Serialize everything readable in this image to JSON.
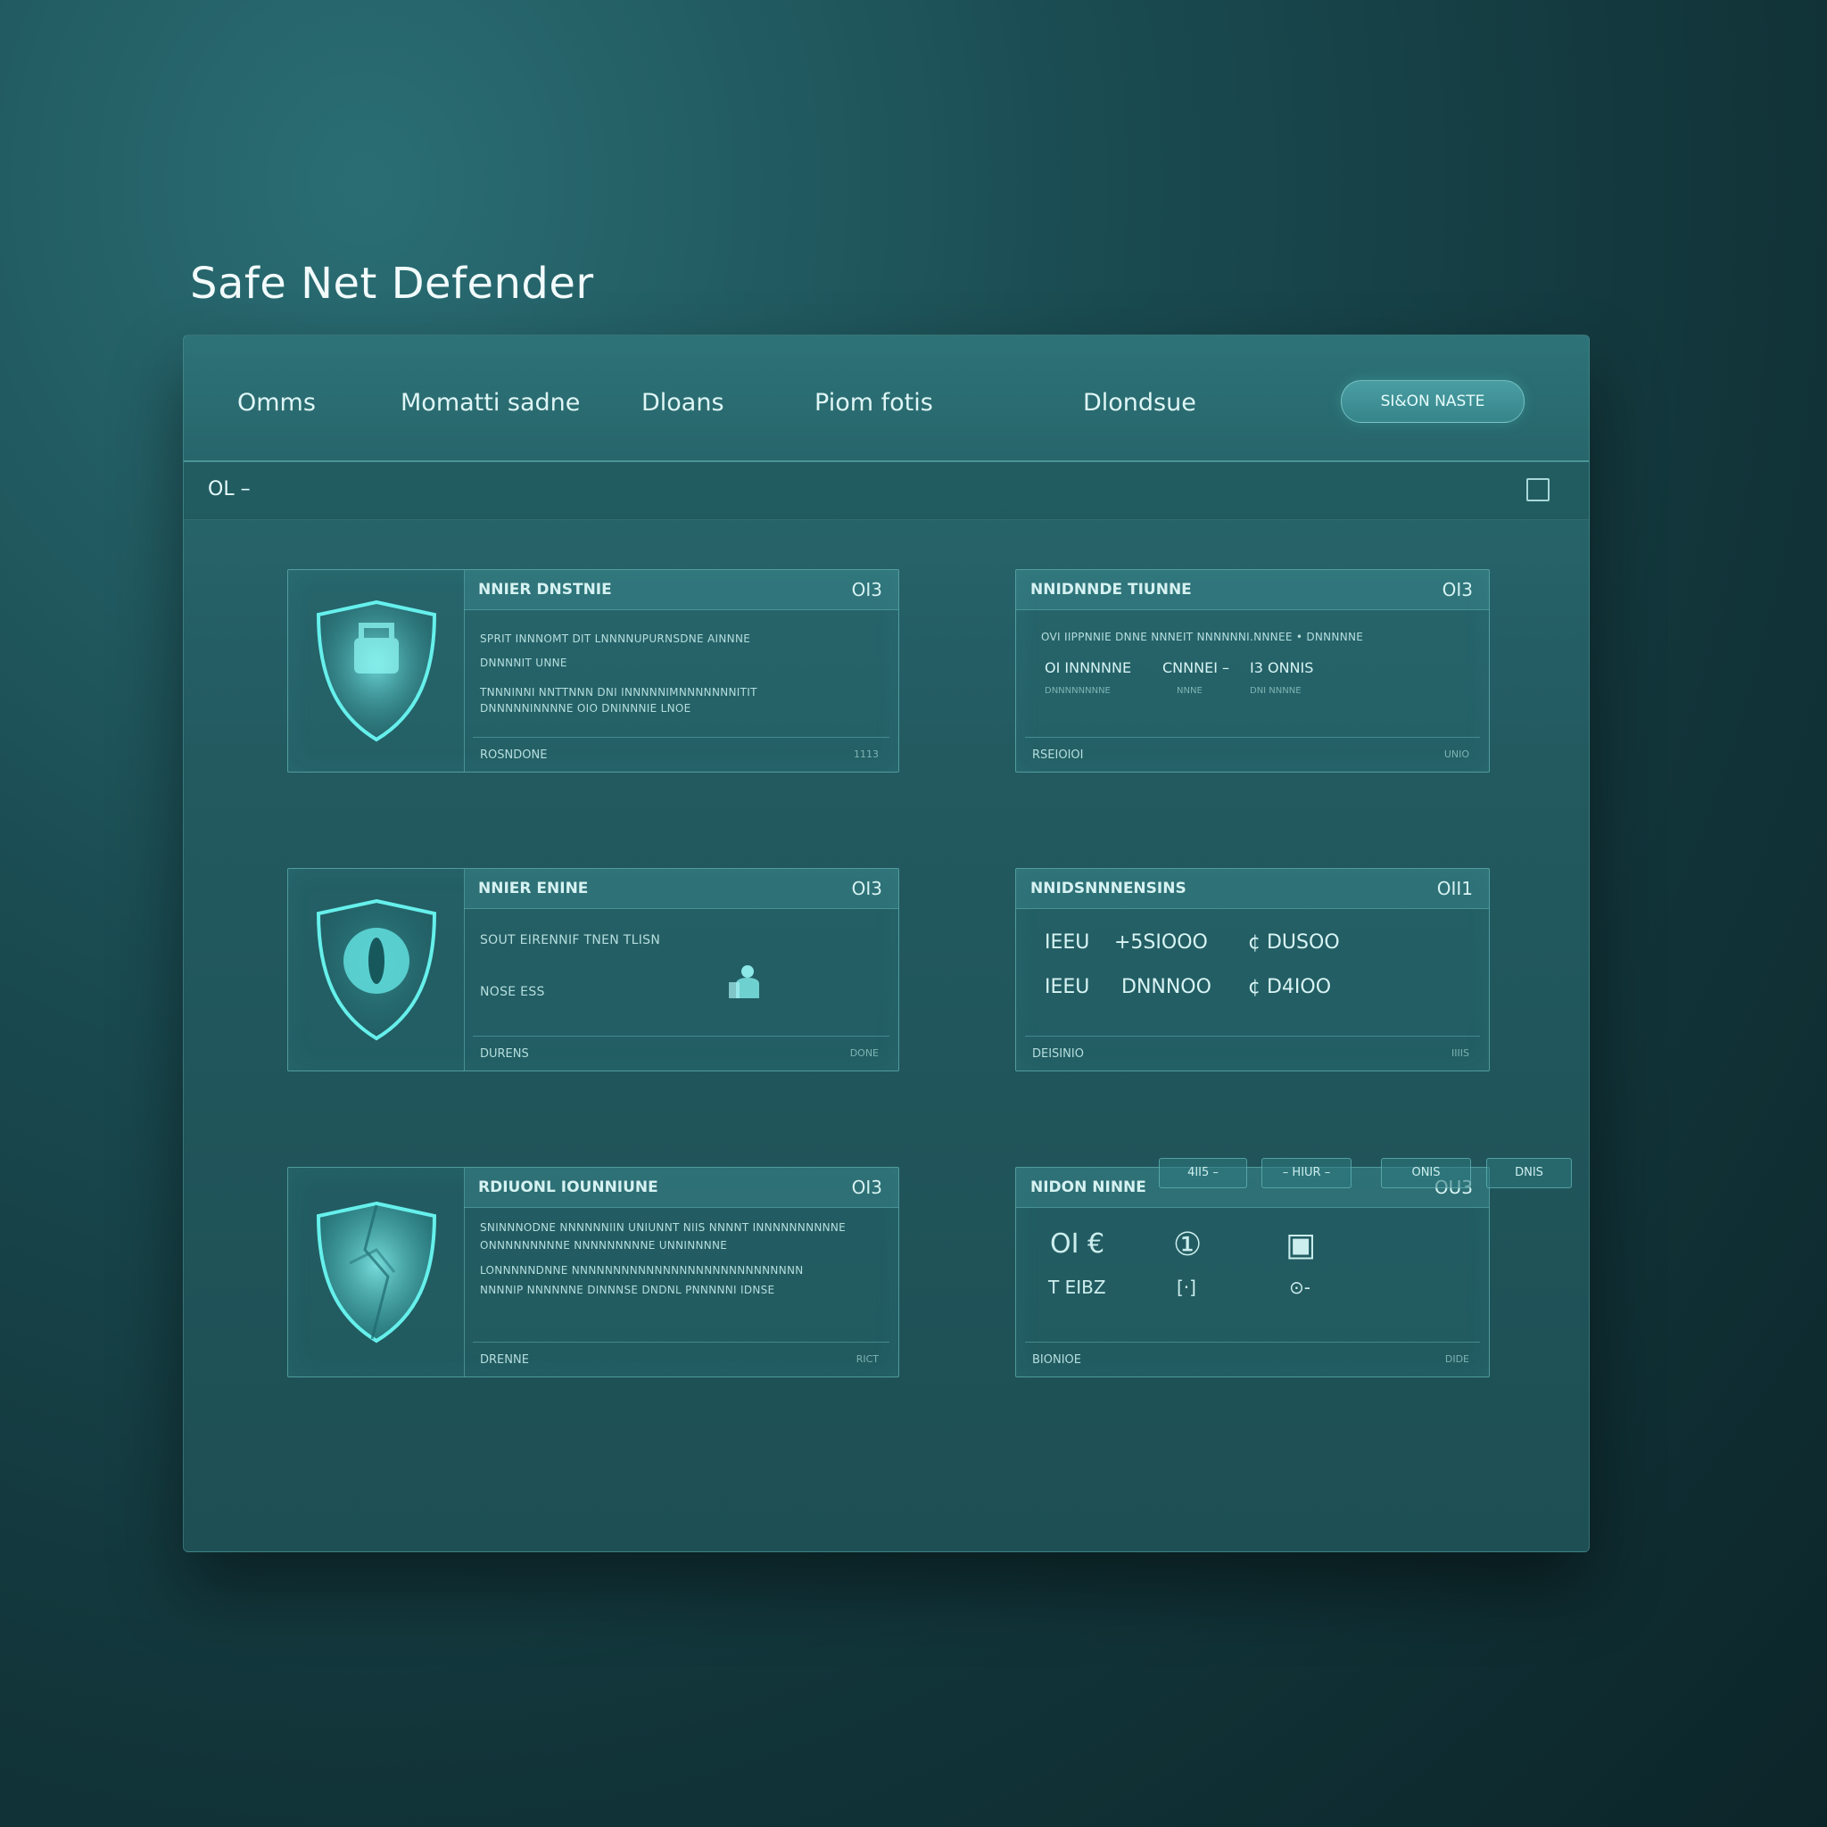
{
  "app": {
    "title": "Safe Net Defender"
  },
  "nav": {
    "items": [
      "Omms",
      "Momatti sadne",
      "Dloans",
      "Piom fotis",
      "Dlondsue"
    ],
    "action_button": "SI&ON NASTE"
  },
  "subbar": {
    "label": "OL –"
  },
  "cards": [
    {
      "title": "NNIER DNSTNIE",
      "badge": "OI3",
      "lines": [
        "SPRIT INNNOMT DIT LNNNNUPURNSDNE  AINNNE",
        "DNNNNIT UNNE",
        "TNNNINNI NNTTNNN  DNI  INNNNNIMNNNNNNNITIT",
        "DNNNNNINNNNE OIO DNINNNIE LNOE"
      ],
      "footer_label": "ROSNDONE",
      "footer_meta": "1113"
    },
    {
      "title": "NNIER ENINE",
      "badge": "OI3",
      "lines": [
        "SOUT  EIRENNIF  TNEN  TLISN",
        "NOSE ESS"
      ],
      "footer_label": "DURENS",
      "footer_meta": "DONE"
    },
    {
      "title": "RDIUONL IOUNNIUNE",
      "badge": "OI3",
      "lines": [
        "SNINNNODNE NNNNNNIIN UNIUNNT NIIS  NNNNT  INNNNNNNNNNE",
        "ONNNNNNNNNE  NNNNNNNNNE UNNINNNNE",
        "LONNNNNDNNE NNNNNNNNNNNNNNNNNNNNNNNNNNNN",
        "NNNNIP NNNNNNE  DINNNSE  DNDNL  PNNNNNI IDNSE"
      ],
      "footer_label": "DRENNE",
      "footer_meta": "RICT"
    },
    {
      "title": "NNIDNNDE TIUNNE",
      "badge": "OI3",
      "lines": [
        "OVI IIPPNNIE DNNE  NNNEIT  NNNNNNI.NNNEE • DNNNNNE"
      ],
      "stats": [
        {
          "big": "OI INNNNNE",
          "small": "DNNNNNNNNE"
        },
        {
          "big": "CNNNEI –",
          "small": "NNNE"
        },
        {
          "big": "I3 ONNIS",
          "small": "DNI  NNNNE"
        }
      ],
      "footer_label": "RSEIOIOI",
      "footer_meta": "UNIO"
    },
    {
      "title": "NNIDSNNNENSINS",
      "badge": "OII1",
      "rows": [
        [
          "IEEU",
          "+5SIOOO",
          "¢ DUSOO"
        ],
        [
          "IEEU",
          "DNNNOO",
          "¢ D4IOO"
        ]
      ],
      "footer_label": "DEISINIO",
      "footer_meta": "IIIIS"
    },
    {
      "title": "NIDON NINNE",
      "badge": "OU3",
      "symbols": [
        {
          "top": "OI €",
          "bottom": "T EIBZ"
        },
        {
          "top": "①",
          "bottom": "[·]"
        },
        {
          "top": "▣",
          "bottom": "⊙-"
        }
      ],
      "footer_label": "BIONIOE",
      "footer_meta": "DIDE"
    }
  ],
  "pager": {
    "buttons": [
      "4II5 –",
      "– HIUR –",
      "ONIS",
      "DNIS"
    ]
  },
  "colors": {
    "accent": "#5fe0e0",
    "panel": "#225a60",
    "background": "#12363b"
  }
}
